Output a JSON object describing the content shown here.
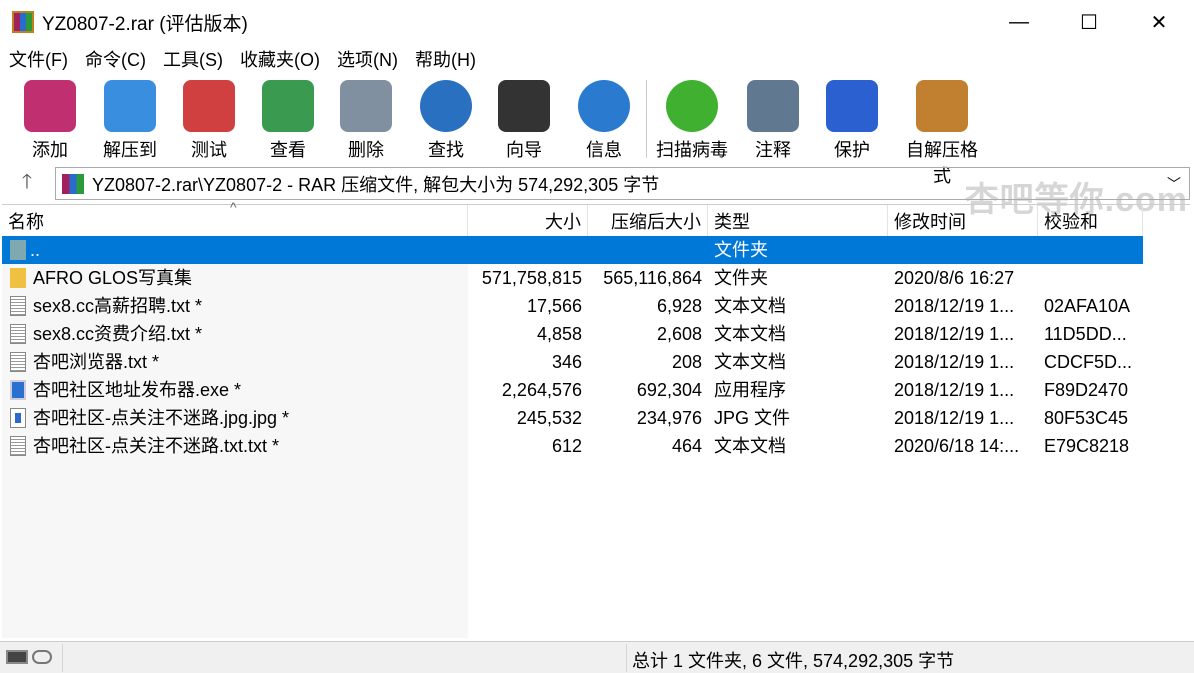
{
  "window": {
    "title": "YZ0807-2.rar (评估版本)",
    "minimize": "—",
    "maximize": "☐",
    "close": "✕"
  },
  "menu": [
    "文件(F)",
    "命令(C)",
    "工具(S)",
    "收藏夹(O)",
    "选项(N)",
    "帮助(H)"
  ],
  "toolbar": [
    {
      "label": "添加",
      "icon": "add-archive-icon",
      "color": "#c03070"
    },
    {
      "label": "解压到",
      "icon": "extract-folder-icon",
      "color": "#3a8ee0"
    },
    {
      "label": "测试",
      "icon": "test-clipboard-icon",
      "color": "#d04040"
    },
    {
      "label": "查看",
      "icon": "view-book-icon",
      "color": "#3a9a50"
    },
    {
      "label": "删除",
      "icon": "trash-icon",
      "color": "#8090a0"
    },
    {
      "label": "查找",
      "icon": "find-magnifier-icon",
      "color": "#2a70c0"
    },
    {
      "label": "向导",
      "icon": "wizard-wand-icon",
      "color": "#333333"
    },
    {
      "label": "信息",
      "icon": "info-icon",
      "color": "#2a7ad0"
    },
    {
      "label": "扫描病毒",
      "icon": "virus-scan-icon",
      "color": "#40b030"
    },
    {
      "label": "注释",
      "icon": "comment-icon",
      "color": "#607890"
    },
    {
      "label": "保护",
      "icon": "shield-icon",
      "color": "#2a60d0"
    },
    {
      "label": "自解压格式",
      "icon": "sfx-icon",
      "color": "#c08030"
    }
  ],
  "watermark": "杏吧等你.com",
  "address": {
    "path": "YZ0807-2.rar\\YZ0807-2 - RAR 压缩文件, 解包大小为 574,292,305 字节",
    "up": "🡑"
  },
  "columns": [
    "名称",
    "大小",
    "压缩后大小",
    "类型",
    "修改时间",
    "校验和"
  ],
  "files": [
    {
      "name": "..",
      "size": "",
      "packed": "",
      "type": "文件夹",
      "modified": "",
      "crc": "",
      "icon": "parent-folder-icon",
      "selected": true
    },
    {
      "name": "AFRO GLOS写真集",
      "size": "571,758,815",
      "packed": "565,116,864",
      "type": "文件夹",
      "modified": "2020/8/6 16:27",
      "crc": "",
      "icon": "folder-icon"
    },
    {
      "name": "sex8.cc高薪招聘.txt *",
      "size": "17,566",
      "packed": "6,928",
      "type": "文本文档",
      "modified": "2018/12/19 1...",
      "crc": "02AFA10A",
      "icon": "text-file-icon"
    },
    {
      "name": "sex8.cc资费介绍.txt *",
      "size": "4,858",
      "packed": "2,608",
      "type": "文本文档",
      "modified": "2018/12/19 1...",
      "crc": "11D5DD...",
      "icon": "text-file-icon"
    },
    {
      "name": "杏吧浏览器.txt *",
      "size": "346",
      "packed": "208",
      "type": "文本文档",
      "modified": "2018/12/19 1...",
      "crc": "CDCF5D...",
      "icon": "text-file-icon"
    },
    {
      "name": "杏吧社区地址发布器.exe *",
      "size": "2,264,576",
      "packed": "692,304",
      "type": "应用程序",
      "modified": "2018/12/19 1...",
      "crc": "F89D2470",
      "icon": "exe-file-icon"
    },
    {
      "name": "杏吧社区-点关注不迷路.jpg.jpg *",
      "size": "245,532",
      "packed": "234,976",
      "type": "JPG 文件",
      "modified": "2018/12/19 1...",
      "crc": "80F53C45",
      "icon": "image-file-icon"
    },
    {
      "name": "杏吧社区-点关注不迷路.txt.txt *",
      "size": "612",
      "packed": "464",
      "type": "文本文档",
      "modified": "2020/6/18 14:...",
      "crc": "E79C8218",
      "icon": "text-file-icon"
    }
  ],
  "status": {
    "summary": "总计 1 文件夹, 6 文件, 574,292,305 字节"
  },
  "colors": {
    "selection": "#0078d7"
  }
}
